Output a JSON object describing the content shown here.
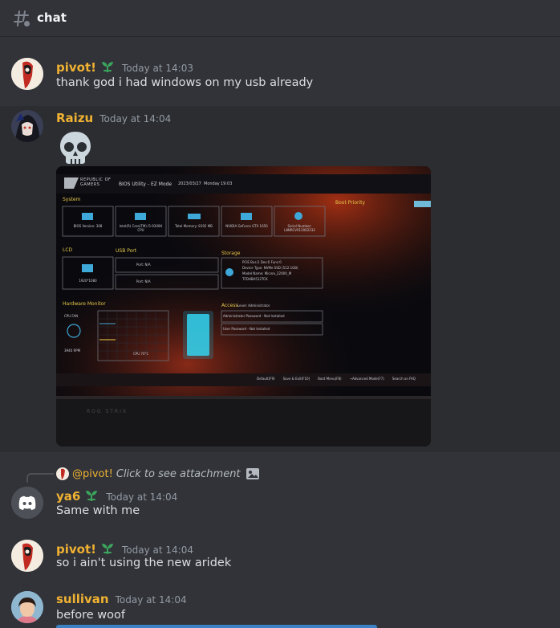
{
  "channel": {
    "name": "chat",
    "icon": "hash-threads-icon"
  },
  "messages": [
    {
      "user": "pivot!",
      "badge": "sprout-icon",
      "time": "Today at 14:03",
      "text": "thank god i had windows on my usb already"
    },
    {
      "user": "Raizu",
      "time": "Today at 14:04",
      "emoji": "skull-emoji",
      "photo": {
        "brand": "REPUBLIC OF GAMERS",
        "title": "BIOS Utility - EZ Mode",
        "date": "2023/03/27",
        "day": "Monday",
        "clock": "19:03",
        "system_label": "System",
        "system_tiles": [
          "BIOS Version: 308",
          "Intel(R) Core(TM) i5-9300H CPU",
          "Total Memory: 8192 MB",
          "NVIDIA GeForce GTX 1650",
          "Serial Number: L8NRCV012062232"
        ],
        "boot_priority": "Boot Priority",
        "lcd_label": "LCD",
        "lcd_value": "1920*1080",
        "usb_label": "USB Port",
        "usb_ports": [
          "Port: N/A",
          "Port: N/A"
        ],
        "storage_label": "Storage",
        "storage_lines": [
          "PCIE Bus:2 Dev:0 Func:0",
          "Device Type:   NVMe SSD (512.1GB)",
          "Model Name:   Micron_2200V_M",
          "TFDHBA512TCK"
        ],
        "hw_label": "Hardware Monitor",
        "fan_label": "CPU FAN",
        "fan_rpm": "3940 RPM",
        "cpu_temp": "CPU  70°C",
        "access_label": "Access",
        "access_level": "Level: Administrator",
        "access_items": [
          "Administrator Password - Not Installed",
          "User Password - Not Installed"
        ],
        "footer": [
          "Default(F9)",
          "Save & Exit(F10)",
          "Boot Menu(F8)",
          "→Advanced Mode(F7)",
          "Search on FAQ"
        ],
        "chassis_text": "ROG STRIX"
      }
    },
    {
      "user": "ya6",
      "badge": "sprout-icon",
      "time": "Today at 14:04",
      "text": "Same with me",
      "reply": {
        "to": "@pivot!",
        "text": "Click to see attachment"
      }
    },
    {
      "user": "pivot!",
      "badge": "sprout-icon",
      "time": "Today at 14:04",
      "text": "so i ain't using the new aridek"
    },
    {
      "user": "sullivan",
      "time": "Today at 14:04",
      "text": "before woof"
    }
  ]
}
